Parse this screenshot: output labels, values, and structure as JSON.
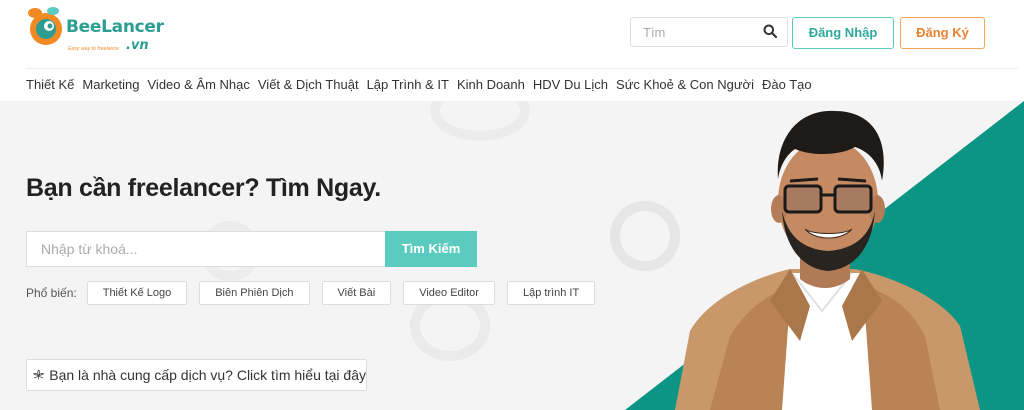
{
  "brand": {
    "name": "BeeLancer",
    "domain_suffix": ".vn",
    "tagline": "Easy way to freelance",
    "colors": {
      "teal": "#2c9d92",
      "accent_teal": "#5ccbbf",
      "orange": "#f28a24"
    }
  },
  "header": {
    "search_placeholder": "Tìm",
    "login_label": "Đăng Nhập",
    "register_label": "Đăng Ký"
  },
  "nav": {
    "items": [
      {
        "label": "Thiết Kế"
      },
      {
        "label": "Marketing"
      },
      {
        "label": "Video & Âm Nhạc"
      },
      {
        "label": "Viết & Dịch Thuật"
      },
      {
        "label": "Lập Trình & IT"
      },
      {
        "label": "Kinh Doanh"
      },
      {
        "label": "HDV Du Lịch"
      },
      {
        "label": "Sức Khoẻ & Con Người"
      },
      {
        "label": "Đào Tạo"
      }
    ]
  },
  "hero": {
    "title": "Bạn cần freelancer? Tìm Ngay.",
    "search_placeholder": "Nhập từ khoá...",
    "search_button": "Tìm Kiếm",
    "popular_label": "Phổ biến:",
    "popular_tags": [
      {
        "label": "Thiết Kế Logo"
      },
      {
        "label": "Biên Phiên Dịch"
      },
      {
        "label": "Viết Bài"
      },
      {
        "label": "Video Editor"
      },
      {
        "label": "Lập trình IT"
      }
    ],
    "provider_link": "Bạn là nhà cung cấp dịch vụ? Click tìm hiểu tại đây"
  },
  "icons": {
    "search": "search-icon",
    "provider": "cannabis-leaf-icon",
    "logo": "bee-logo-icon"
  }
}
